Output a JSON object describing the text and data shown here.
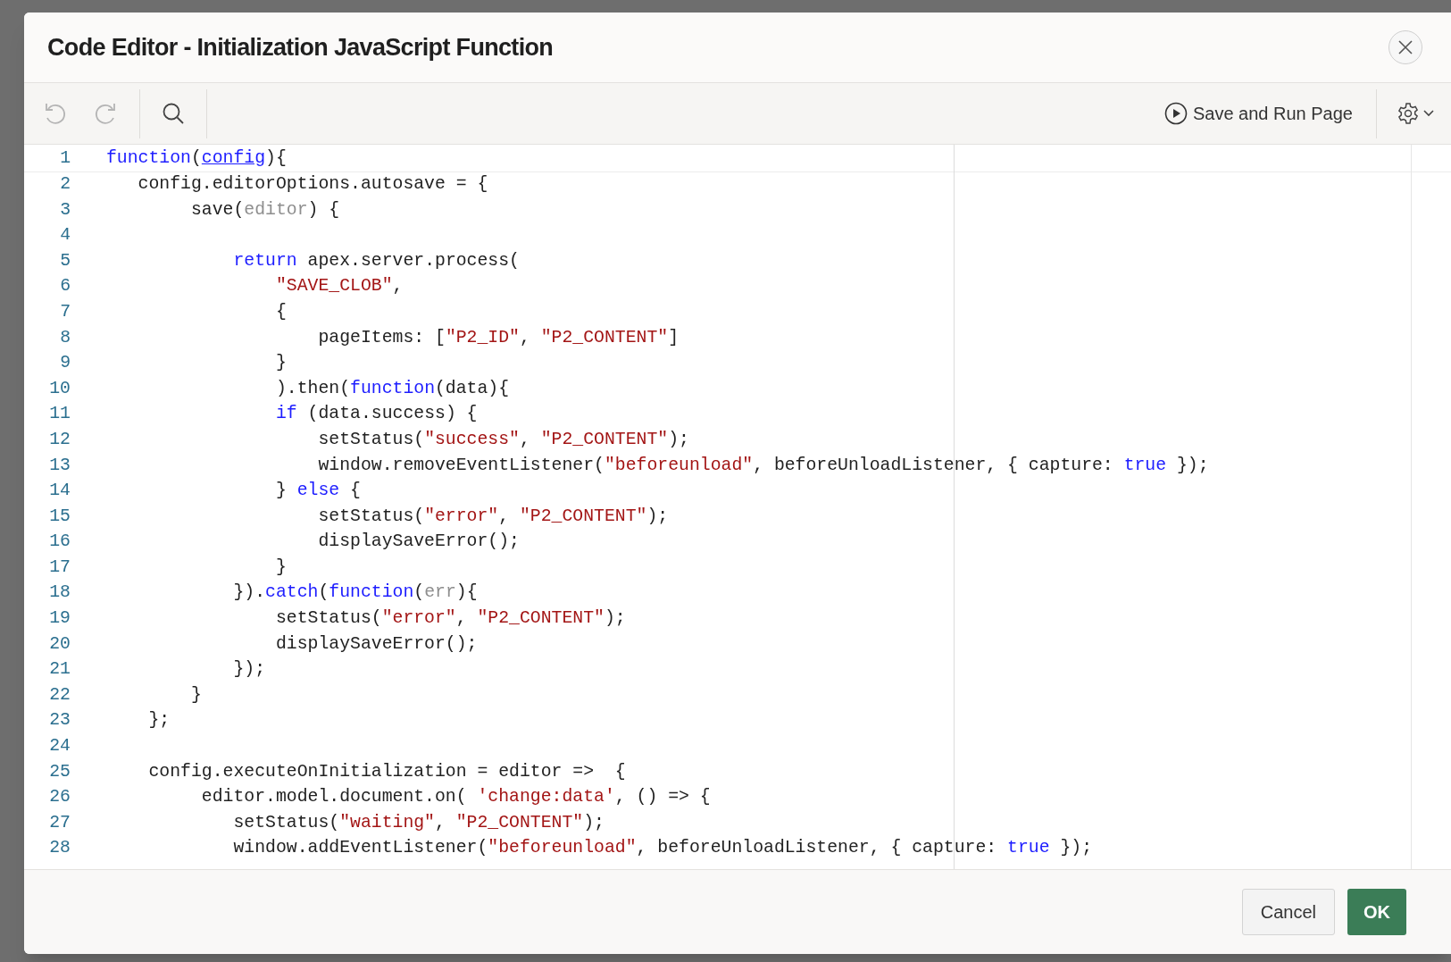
{
  "dialog": {
    "title": "Code Editor - Initialization JavaScript Function"
  },
  "toolbar": {
    "undo": {
      "disabled": true
    },
    "redo": {
      "disabled": true
    },
    "run_button": "Save and Run Page"
  },
  "code_lines": [
    {
      "number": "1",
      "current": true,
      "tokens": [
        {
          "text": "function",
          "kind": "keyword"
        },
        {
          "text": "(",
          "kind": "plain"
        },
        {
          "text": "config",
          "kind": "match"
        },
        {
          "text": "){",
          "kind": "plain"
        }
      ]
    },
    {
      "number": "2",
      "current": false,
      "tokens": [
        {
          "text": "   config.editorOptions.autosave = {",
          "kind": "plain"
        }
      ]
    },
    {
      "number": "3",
      "current": false,
      "tokens": [
        {
          "text": "        save(",
          "kind": "plain"
        },
        {
          "text": "editor",
          "kind": "muted"
        },
        {
          "text": ") {",
          "kind": "plain"
        }
      ]
    },
    {
      "number": "4",
      "current": false
    },
    {
      "number": "5",
      "current": false,
      "tokens": [
        {
          "text": "            return",
          "kind": "keyword"
        },
        {
          "text": " apex.server.process(",
          "kind": "plain"
        }
      ]
    },
    {
      "number": "6",
      "current": false,
      "tokens": [
        {
          "text": "                \"SAVE_CLOB\"",
          "kind": "string"
        },
        {
          "text": ",",
          "kind": "plain"
        }
      ]
    },
    {
      "number": "7",
      "current": false,
      "tokens": [
        {
          "text": "                {",
          "kind": "plain"
        }
      ]
    },
    {
      "number": "8",
      "current": false,
      "tokens": [
        {
          "text": "                    pageItems: [",
          "kind": "plain"
        },
        {
          "text": "\"P2_ID\"",
          "kind": "string"
        },
        {
          "text": ", ",
          "kind": "plain"
        },
        {
          "text": "\"P2_CONTENT\"",
          "kind": "string"
        },
        {
          "text": "]",
          "kind": "plain"
        }
      ]
    },
    {
      "number": "9",
      "current": false,
      "tokens": [
        {
          "text": "                }",
          "kind": "plain"
        }
      ]
    },
    {
      "number": "10",
      "current": false,
      "tokens": [
        {
          "text": "                ).then(",
          "kind": "plain"
        },
        {
          "text": "function",
          "kind": "keyword"
        },
        {
          "text": "(data){",
          "kind": "plain"
        }
      ]
    },
    {
      "number": "11",
      "current": false,
      "tokens": [
        {
          "text": "                if",
          "kind": "keyword"
        },
        {
          "text": " (data.success) {",
          "kind": "plain"
        }
      ]
    },
    {
      "number": "12",
      "current": false,
      "tokens": [
        {
          "text": "                    setStatus(",
          "kind": "plain"
        },
        {
          "text": "\"success\"",
          "kind": "string"
        },
        {
          "text": ", ",
          "kind": "plain"
        },
        {
          "text": "\"P2_CONTENT\"",
          "kind": "string"
        },
        {
          "text": ");",
          "kind": "plain"
        }
      ]
    },
    {
      "number": "13",
      "current": false,
      "tokens": [
        {
          "text": "                    window.removeEventListener(",
          "kind": "plain"
        },
        {
          "text": "\"beforeunload\"",
          "kind": "string"
        },
        {
          "text": ", beforeUnloadListener, { capture: ",
          "kind": "plain"
        },
        {
          "text": "true",
          "kind": "keyword"
        },
        {
          "text": " });",
          "kind": "plain"
        }
      ]
    },
    {
      "number": "14",
      "current": false,
      "tokens": [
        {
          "text": "                } ",
          "kind": "plain"
        },
        {
          "text": "else",
          "kind": "keyword"
        },
        {
          "text": " {",
          "kind": "plain"
        }
      ]
    },
    {
      "number": "15",
      "current": false,
      "tokens": [
        {
          "text": "                    setStatus(",
          "kind": "plain"
        },
        {
          "text": "\"error\"",
          "kind": "string"
        },
        {
          "text": ", ",
          "kind": "plain"
        },
        {
          "text": "\"P2_CONTENT\"",
          "kind": "string"
        },
        {
          "text": ");",
          "kind": "plain"
        }
      ]
    },
    {
      "number": "16",
      "current": false,
      "tokens": [
        {
          "text": "                    displaySaveError();",
          "kind": "plain"
        }
      ]
    },
    {
      "number": "17",
      "current": false,
      "tokens": [
        {
          "text": "                }",
          "kind": "plain"
        }
      ]
    },
    {
      "number": "18",
      "current": false,
      "tokens": [
        {
          "text": "            }).",
          "kind": "plain"
        },
        {
          "text": "catch",
          "kind": "keyword"
        },
        {
          "text": "(",
          "kind": "plain"
        },
        {
          "text": "function",
          "kind": "keyword"
        },
        {
          "text": "(",
          "kind": "plain"
        },
        {
          "text": "err",
          "kind": "muted"
        },
        {
          "text": "){",
          "kind": "plain"
        }
      ]
    },
    {
      "number": "19",
      "current": false,
      "tokens": [
        {
          "text": "                setStatus(",
          "kind": "plain"
        },
        {
          "text": "\"error\"",
          "kind": "string"
        },
        {
          "text": ", ",
          "kind": "plain"
        },
        {
          "text": "\"P2_CONTENT\"",
          "kind": "string"
        },
        {
          "text": ");",
          "kind": "plain"
        }
      ]
    },
    {
      "number": "20",
      "current": false,
      "tokens": [
        {
          "text": "                displaySaveError();",
          "kind": "plain"
        }
      ]
    },
    {
      "number": "21",
      "current": false,
      "tokens": [
        {
          "text": "            });",
          "kind": "plain"
        }
      ]
    },
    {
      "number": "22",
      "current": false,
      "tokens": [
        {
          "text": "        }",
          "kind": "plain"
        }
      ]
    },
    {
      "number": "23",
      "current": false,
      "tokens": [
        {
          "text": "    };",
          "kind": "plain"
        }
      ]
    },
    {
      "number": "24",
      "current": false
    },
    {
      "number": "25",
      "current": false,
      "tokens": [
        {
          "text": "    config.executeOnInitialization = editor =>  {",
          "kind": "plain"
        }
      ]
    },
    {
      "number": "26",
      "current": false,
      "tokens": [
        {
          "text": "         editor.model.document.on( ",
          "kind": "plain"
        },
        {
          "text": "'change:data'",
          "kind": "string"
        },
        {
          "text": ", () => {",
          "kind": "plain"
        }
      ]
    },
    {
      "number": "27",
      "current": false,
      "tokens": [
        {
          "text": "            setStatus(",
          "kind": "plain"
        },
        {
          "text": "\"waiting\"",
          "kind": "string"
        },
        {
          "text": ", ",
          "kind": "plain"
        },
        {
          "text": "\"P2_CONTENT\"",
          "kind": "string"
        },
        {
          "text": ");",
          "kind": "plain"
        }
      ]
    },
    {
      "number": "28",
      "current": false,
      "tokens": [
        {
          "text": "            window.addEventListener(",
          "kind": "plain"
        },
        {
          "text": "\"beforeunload\"",
          "kind": "string"
        },
        {
          "text": ", beforeUnloadListener, { capture: ",
          "kind": "plain"
        },
        {
          "text": "true",
          "kind": "keyword"
        },
        {
          "text": " });",
          "kind": "plain"
        }
      ]
    }
  ],
  "footer": {
    "cancel": "Cancel",
    "ok": "OK"
  }
}
